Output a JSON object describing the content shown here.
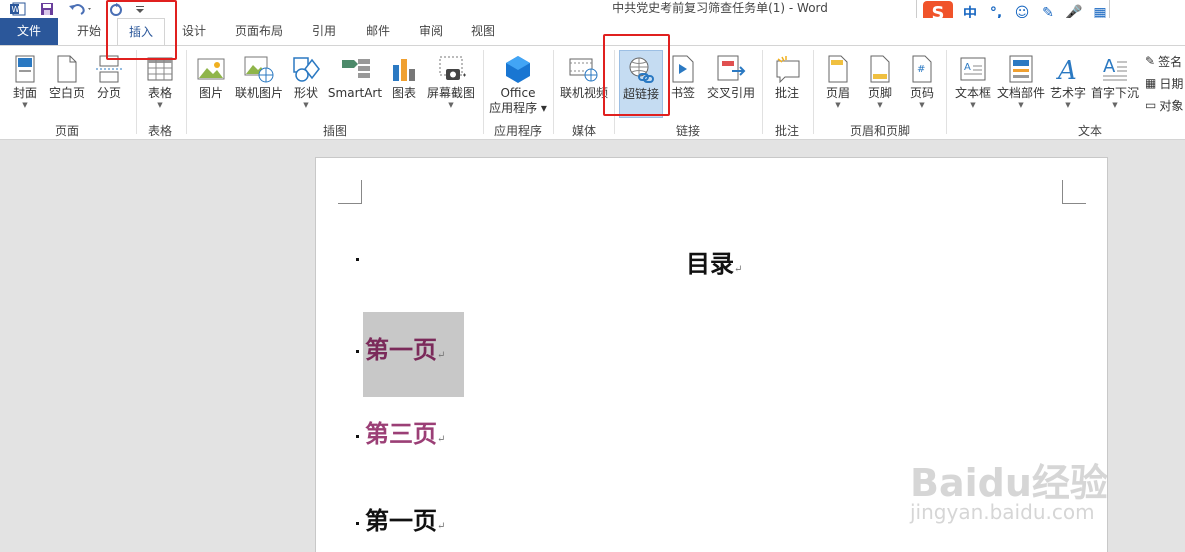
{
  "window": {
    "title": "中共党史考前复习筛查任务单(1) - Word"
  },
  "quick_access": {
    "word_icon": "word-icon",
    "save_icon": "save-icon",
    "undo_icon": "undo-icon",
    "redo_icon": "redo-icon",
    "customize_icon": "customize-qat-icon"
  },
  "ime": {
    "logo": "S",
    "items": [
      "中",
      "°,",
      "☺",
      "✎",
      "🎤",
      "▦"
    ]
  },
  "tabs": [
    "文件",
    "开始",
    "插入",
    "设计",
    "页面布局",
    "引用",
    "邮件",
    "审阅",
    "视图"
  ],
  "ribbon": {
    "buttons": {
      "cover": "封面",
      "blank_page": "空白页",
      "page_break": "分页",
      "table": "表格",
      "picture": "图片",
      "online_picture": "联机图片",
      "shapes": "形状",
      "smartart": "SmartArt",
      "chart": "图表",
      "screenshot": "屏幕截图",
      "office_line1": "Office",
      "office_line2": "应用程序",
      "online_video": "联机视频",
      "hyperlink": "超链接",
      "bookmark": "书签",
      "cross_ref": "交叉引用",
      "comment": "批注",
      "header": "页眉",
      "footer": "页脚",
      "page_number": "页码",
      "textbox": "文本框",
      "quick_parts": "文档部件",
      "wordart": "艺术字",
      "dropcap": "首字下沉",
      "signature": "签名",
      "datetime": "日期",
      "object": "对象"
    },
    "groups": {
      "pages": "页面",
      "tables": "表格",
      "illustrations": "插图",
      "apps": "应用程序",
      "media": "媒体",
      "links": "链接",
      "comments": "批注",
      "header_footer": "页眉和页脚",
      "text": "文本"
    }
  },
  "document": {
    "lines": [
      {
        "text": "目录",
        "mark": "↵",
        "color": "#111111"
      },
      {
        "text": "第一页",
        "mark": "↵",
        "color": "#7b2a5a",
        "selected": true
      },
      {
        "text": "第三页",
        "mark": "↵",
        "color": "#9b3f76"
      },
      {
        "text": "第一页",
        "mark": "↵",
        "color": "#111111"
      }
    ]
  },
  "watermark": {
    "brand": "Baidu经验",
    "url": "jingyan.baidu.com"
  },
  "colors": {
    "accent": "#2b579a",
    "highlight_box": "#e0201f",
    "selection": "#c8c8c8"
  }
}
